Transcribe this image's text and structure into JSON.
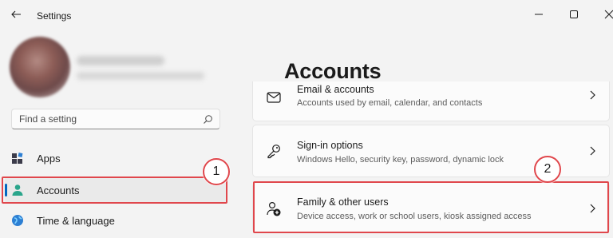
{
  "window": {
    "title": "Settings"
  },
  "search": {
    "placeholder": "Find a setting"
  },
  "sidebar": {
    "items": [
      {
        "label": "Apps",
        "icon": "apps-icon"
      },
      {
        "label": "Accounts",
        "icon": "accounts-icon",
        "active": true
      },
      {
        "label": "Time & language",
        "icon": "time-language-icon"
      }
    ]
  },
  "main": {
    "title": "Accounts",
    "cards": [
      {
        "title": "Email & accounts",
        "description": "Accounts used by email, calendar, and contacts",
        "icon": "mail-icon"
      },
      {
        "title": "Sign-in options",
        "description": "Windows Hello, security key, password, dynamic lock",
        "icon": "key-icon"
      },
      {
        "title": "Family & other users",
        "description": "Device access, work or school users, kiosk assigned access",
        "icon": "family-users-icon"
      }
    ]
  },
  "annotations": {
    "callout_1": "1",
    "callout_2": "2",
    "highlight_color": "#e0474c"
  },
  "colors": {
    "accent": "#0067c0",
    "background": "#f3f3f3",
    "card": "#fbfbfb"
  }
}
